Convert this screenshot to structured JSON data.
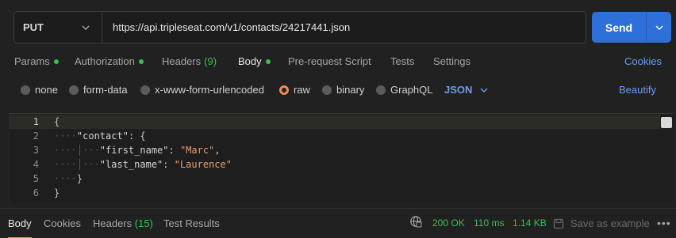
{
  "request": {
    "method": "PUT",
    "url": "https://api.tripleseat.com/v1/contacts/24217441.json",
    "send_label": "Send"
  },
  "tabs": [
    {
      "label": "Params",
      "dot": true
    },
    {
      "label": "Authorization",
      "dot": true
    },
    {
      "label": "Headers",
      "count": "(9)"
    },
    {
      "label": "Body",
      "dot": true,
      "active": true
    },
    {
      "label": "Pre-request Script"
    },
    {
      "label": "Tests"
    },
    {
      "label": "Settings"
    }
  ],
  "cookies_link": "Cookies",
  "body_types": [
    "none",
    "form-data",
    "x-www-form-urlencoded",
    "raw",
    "binary",
    "GraphQL"
  ],
  "selected_body_type": "raw",
  "format": "JSON",
  "beautify_label": "Beautify",
  "editor": {
    "line_numbers": [
      "1",
      "2",
      "3",
      "4",
      "5",
      "6"
    ],
    "lines": [
      {
        "indent": "",
        "text": "{"
      },
      {
        "indent": "····",
        "key": "\"contact\"",
        "sep": ": ",
        "text": "{"
      },
      {
        "indent": "····│···",
        "key": "\"first_name\"",
        "sep": ": ",
        "str": "\"Marc\"",
        "tail": ","
      },
      {
        "indent": "····│···",
        "key": "\"last_name\"",
        "sep": ": ",
        "str": "\"Laurence\""
      },
      {
        "indent": "····",
        "text": "}"
      },
      {
        "indent": "",
        "text": "}"
      }
    ]
  },
  "response": {
    "tabs": [
      {
        "label": "Body",
        "active": true
      },
      {
        "label": "Cookies"
      },
      {
        "label": "Headers",
        "count": "(15)"
      },
      {
        "label": "Test Results"
      }
    ],
    "status": "200 OK",
    "time": "110 ms",
    "size": "1.14 KB",
    "save_label": "Save as example",
    "more_label": "•••"
  },
  "colors": {
    "accent": "#2f6fda",
    "link": "#6b9df0",
    "success": "#3fbd56",
    "radio_selected": "#f08a5d"
  }
}
